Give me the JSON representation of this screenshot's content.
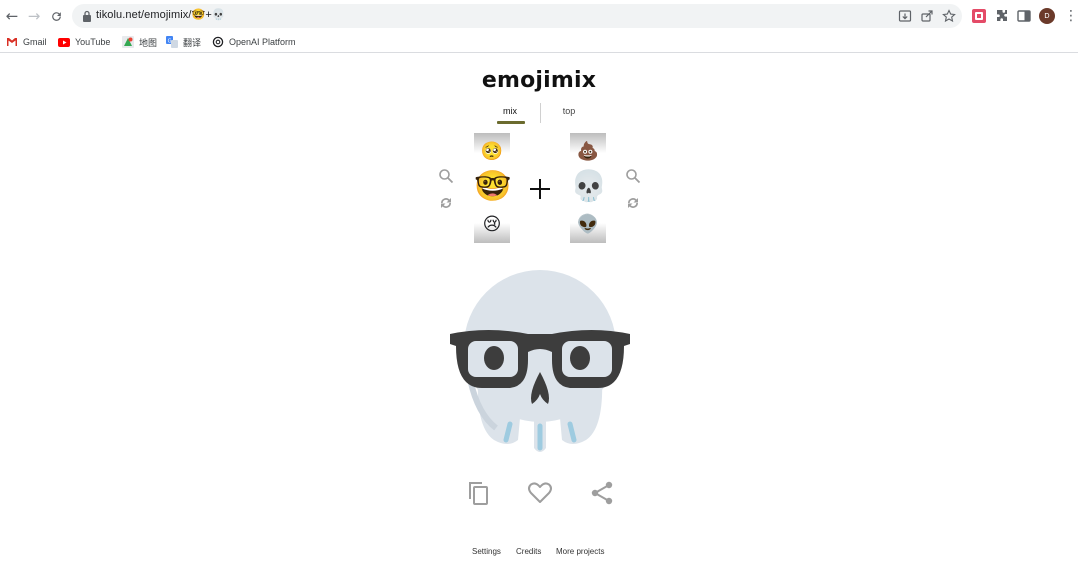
{
  "browser": {
    "url": "tikolu.net/emojimix/🤓+💀",
    "profile_initial": "D",
    "bookmarks": [
      {
        "label": "Gmail",
        "icon": "gmail-icon"
      },
      {
        "label": "YouTube",
        "icon": "youtube-icon"
      },
      {
        "label": "地图",
        "icon": "maps-icon"
      },
      {
        "label": "翻译",
        "icon": "translate-icon"
      },
      {
        "label": "OpenAI Platform",
        "icon": "openai-icon"
      }
    ]
  },
  "app": {
    "title": "emojimix",
    "tabs": [
      {
        "label": "mix",
        "active": true
      },
      {
        "label": "top",
        "active": false
      }
    ],
    "left_strip": {
      "above": "🥺",
      "selected": "🤓",
      "below": "😢"
    },
    "right_strip": {
      "above": "💩",
      "selected": "💀",
      "below": "👽"
    },
    "result_emoji": "nerd-face + skull",
    "actions": [
      "copy-icon",
      "heart-icon",
      "share-icon"
    ],
    "footer_links": [
      "Settings",
      "Credits",
      "More projects"
    ]
  },
  "colors": {
    "accent_underline": "#6b6b2e",
    "skull": "#dce3ea",
    "glasses": "#3d3d3d",
    "icon_gray": "#9e9e9e"
  }
}
